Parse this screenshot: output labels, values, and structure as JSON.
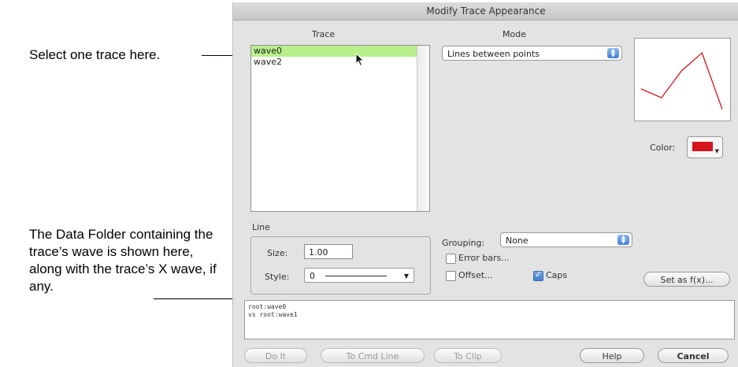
{
  "callouts": {
    "select_trace": "Select one trace here.",
    "data_folder": "The Data Folder containing the trace’s wave is shown here, along with the trace’s X wave, if any."
  },
  "dialog": {
    "title": "Modify Trace Appearance",
    "trace_header": "Trace",
    "mode_header": "Mode",
    "traces": [
      {
        "name": "wave0",
        "selected": true
      },
      {
        "name": "wave2",
        "selected": false
      }
    ],
    "mode_value": "Lines between points",
    "color_label": "Color:",
    "color_value": "#d6141c",
    "line_group": {
      "legend": "Line",
      "size_label": "Size:",
      "size_value": "1.00",
      "style_label": "Style:",
      "style_value": "0"
    },
    "grouping_label": "Grouping:",
    "grouping_value": "None",
    "error_bars_label": "Error bars...",
    "error_bars_checked": false,
    "offset_label": "Offset...",
    "offset_checked": false,
    "caps_label": "Caps",
    "caps_checked": true,
    "set_as_default_label": "Set as f(x)...",
    "data_path_lines": [
      "root:wave0",
      "vs root:wave1"
    ],
    "buttons": {
      "do_it": "Do It",
      "to_cmd_line": "To Cmd Line",
      "to_clip": "To Clip",
      "help": "Help",
      "cancel": "Cancel"
    }
  },
  "preview": {
    "points": [
      [
        0,
        0.35
      ],
      [
        1,
        0.22
      ],
      [
        2,
        0.62
      ],
      [
        3,
        0.88
      ],
      [
        4,
        0.05
      ]
    ],
    "color": "#d6141c"
  }
}
